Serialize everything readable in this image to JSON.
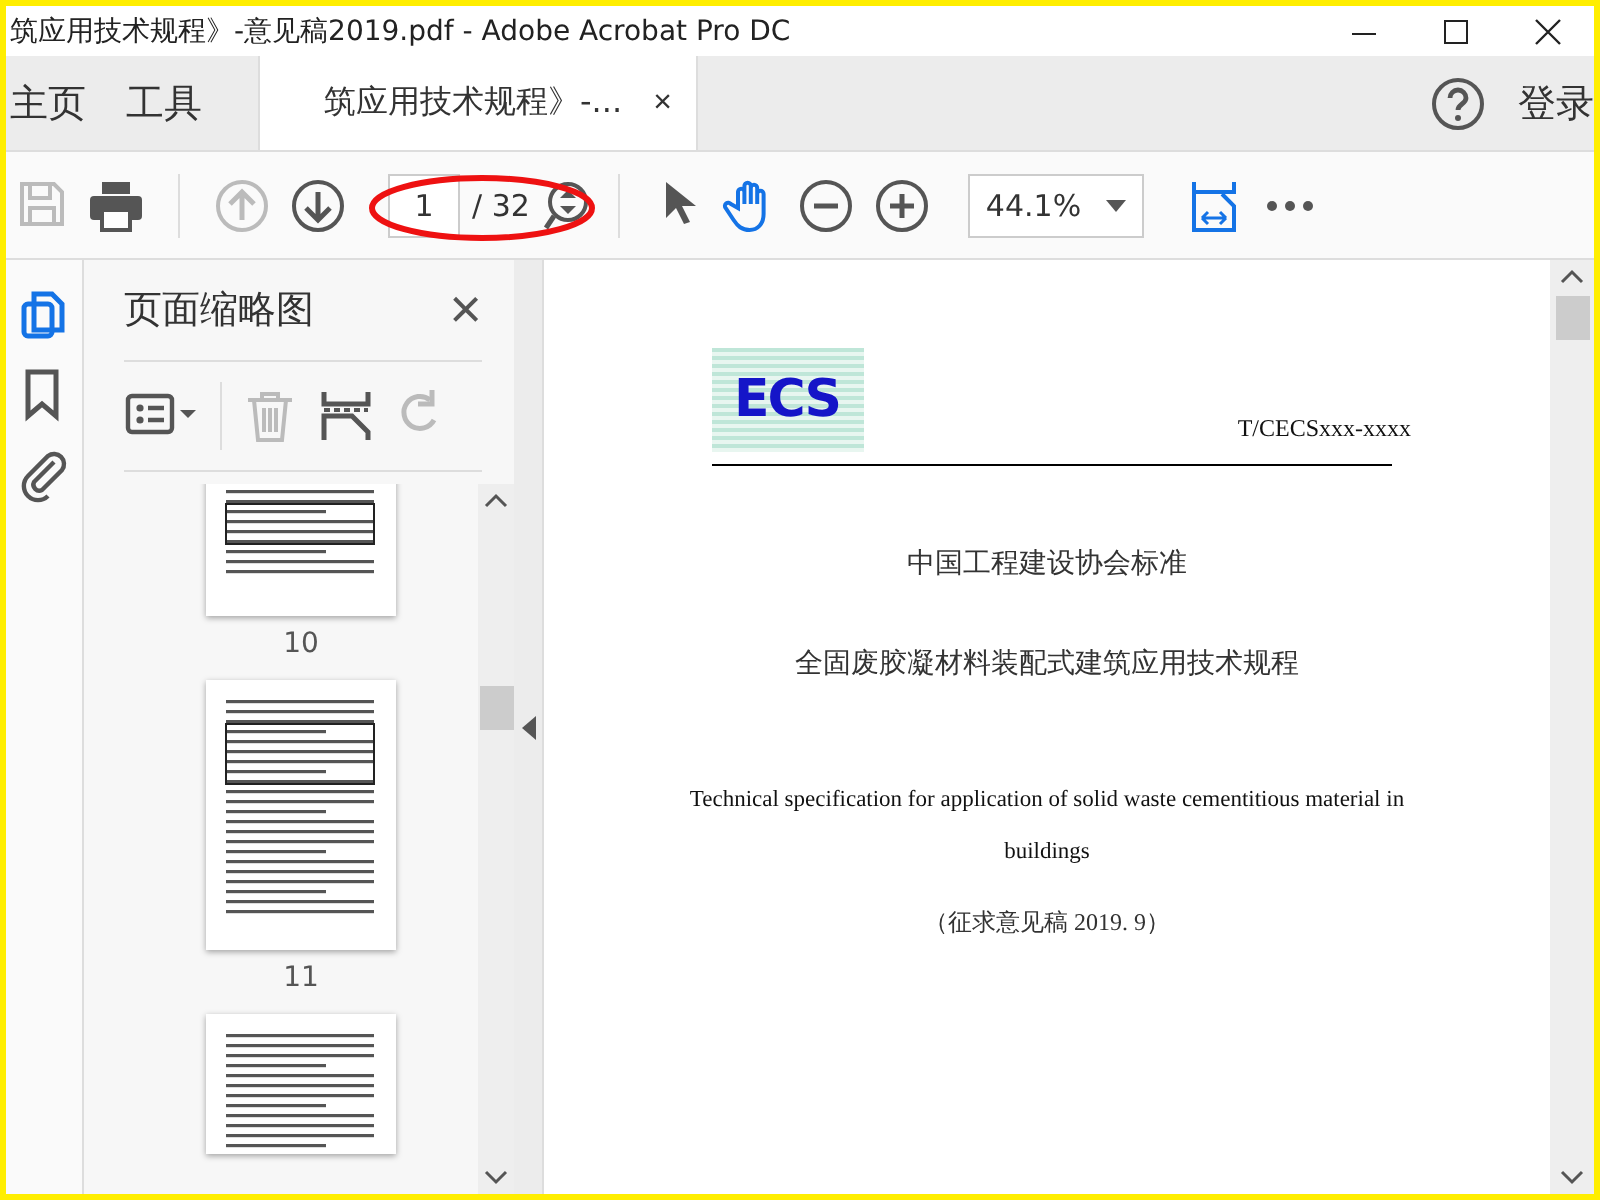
{
  "window": {
    "title": "筑应用技术规程》-意见稿2019.pdf - Adobe Acrobat Pro DC"
  },
  "nav_tabs": [
    {
      "label": "主页"
    },
    {
      "label": "工具"
    }
  ],
  "document_tab": {
    "label": "筑应用技术规程》-...",
    "close": "×"
  },
  "sign_in": "登录",
  "toolbar": {
    "tools": [
      {
        "kind": "save",
        "disabled": true
      },
      {
        "kind": "print",
        "disabled": false
      },
      {
        "kind": "sep"
      },
      {
        "kind": "prev",
        "disabled": true
      },
      {
        "kind": "next",
        "disabled": false
      },
      {
        "kind": "page"
      },
      {
        "kind": "sep"
      },
      {
        "kind": "pointer",
        "disabled": false,
        "selected": false
      },
      {
        "kind": "hand",
        "disabled": false,
        "selected": true
      },
      {
        "kind": "zoomout",
        "disabled": false
      },
      {
        "kind": "zoomin",
        "disabled": false
      },
      {
        "kind": "zoom"
      },
      {
        "kind": "fit",
        "disabled": false
      },
      {
        "kind": "more",
        "disabled": false
      }
    ],
    "page_input": "1",
    "page_total": "/ 32",
    "zoom": "44.1%"
  },
  "side_icons": [
    {
      "kind": "pages",
      "selected": true
    },
    {
      "kind": "bookmarks",
      "selected": false
    },
    {
      "kind": "attachments",
      "selected": false
    }
  ],
  "thumbnail_panel": {
    "title": "页面缩略图",
    "close": "×",
    "tools": [
      {
        "kind": "options",
        "disabled": false
      },
      {
        "kind": "delete",
        "disabled": true
      },
      {
        "kind": "insert",
        "disabled": false
      },
      {
        "kind": "undo",
        "disabled": true
      }
    ],
    "thumbnails": [
      {
        "kind": "page",
        "label": "10"
      },
      {
        "kind": "page",
        "label": "11"
      },
      {
        "kind": "page"
      }
    ]
  },
  "document": {
    "logo": "ECS",
    "code": "T/CECSxxx-xxxx",
    "org": "中国工程建设协会标准",
    "title_cn": "全固废胶凝材料装配式建筑应用技术规程",
    "title_en": "Technical specification for application of solid waste cementitious material in buildings",
    "draft": "（征求意见稿 2019. 9）"
  }
}
